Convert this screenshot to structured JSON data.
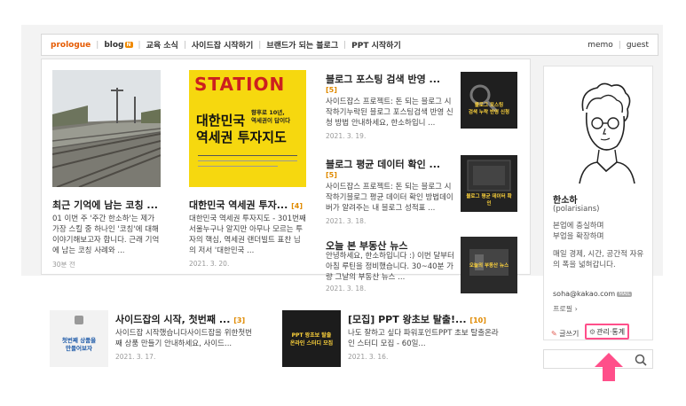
{
  "nav": {
    "items": [
      {
        "label": "prologue",
        "active": true
      },
      {
        "label": "blog",
        "badge": "N"
      },
      {
        "label": "교육 소식"
      },
      {
        "label": "사이드잡 시작하기"
      },
      {
        "label": "브랜드가 되는 블로그"
      },
      {
        "label": "PPT 시작하기"
      }
    ],
    "right": [
      "memo",
      "guest"
    ]
  },
  "posts": {
    "p1": {
      "title": "최근 기억에 남는 코칭 ...",
      "excerpt": "01 이번 주 '주간 한소하'는 제가 가장 스킬 중 하나인 '코칭'에 대해 이야기해보고자 합니다. 근래 기억에 남는 코칭 사례와 ...",
      "date": "30분 전"
    },
    "p2": {
      "title": "대한민국 역세권 투자...",
      "count": "[4]",
      "excerpt": "대한민국 역세권 투자지도 - 301번째 서울누구나 알지만 아무나 모르는 투자의 핵심, 역세권 랜더빌트 표찬 님의 저서 '대한민국 ...",
      "date": "2021. 3. 20.",
      "cover_title_top": "STATION",
      "cover_title_main": "대한민국\n역세권 투자지도",
      "cover_sub": "향후로 10년,\n역세권이 답이다"
    },
    "p3": {
      "title": "블로그 포스팅 검색 반영 ...",
      "count": "[5]",
      "excerpt": "사이드잡스 프로젝트: 돈 되는 블로그 시작하기누락된 블로그 포스팅검색 반영 신청 방법 안내하세요, 한소하입니 ...",
      "date": "2021. 3. 19.",
      "thumb_text": "블로그 포스팅\n검색 누락 반영 신청"
    },
    "p4": {
      "title": "블로그 평균 데이터 확인 ...",
      "count": "[5]",
      "excerpt": "사이드잡스 프로젝트: 돈 되는 블로그 시작하기블로그 평균 데이터 확인 방법데이버가 알려주는 내 블로그 성적표 ...",
      "date": "2021. 3. 18.",
      "thumb_text": "블로그 평균 데이터 확인"
    },
    "p5": {
      "title": "오늘 본 부동산 뉴스",
      "excerpt": "안녕하세요, 한소하입니다 :) 이번 달부터 아침 루틴을 정비했습니다. 30~40분 가량 그날의 부동산 뉴스 ...",
      "date": "2021. 3. 18.",
      "thumb_text": "오늘의 부동산 뉴스"
    },
    "p6": {
      "title": "사이드잡의 시작, 첫번째 ...",
      "count": "[3]",
      "excerpt": "사이드잡 시작했습니다사이드잡을 위한첫번째 상품 만들기 안내하세요, 사이드...",
      "date": "2021. 3. 17.",
      "thumb_text": "첫번째 상품을\n만들어보자"
    },
    "p7": {
      "title": "[모집] PPT 왕초보 탈출!...",
      "count": "[10]",
      "excerpt": "나도 잘하고 싶다 파워포인트PPT 초보 탈출온라인 스터디 모집 - 60일...",
      "date": "2021. 3. 16.",
      "thumb_text": "PPT 왕초보 탈출\n온라인 스터디 모집"
    }
  },
  "profile": {
    "name": "한소하",
    "handle": "(polarisians)",
    "bio": "본업에 충실하며\n부업을 확장하며",
    "bio2": "매일 경제, 시간, 공간적 자유의 폭을 넓혀갑니다.",
    "email": "soha@kakao.com",
    "email_badge": "MAIL",
    "profile_link": "프로필 ›",
    "write_label": "글쓰기",
    "admin_label": "관리·통계"
  },
  "search": {
    "placeholder": ""
  },
  "colors": {
    "accent": "#e55a00",
    "highlight": "#ff4f8a",
    "count": "#e08a00"
  }
}
